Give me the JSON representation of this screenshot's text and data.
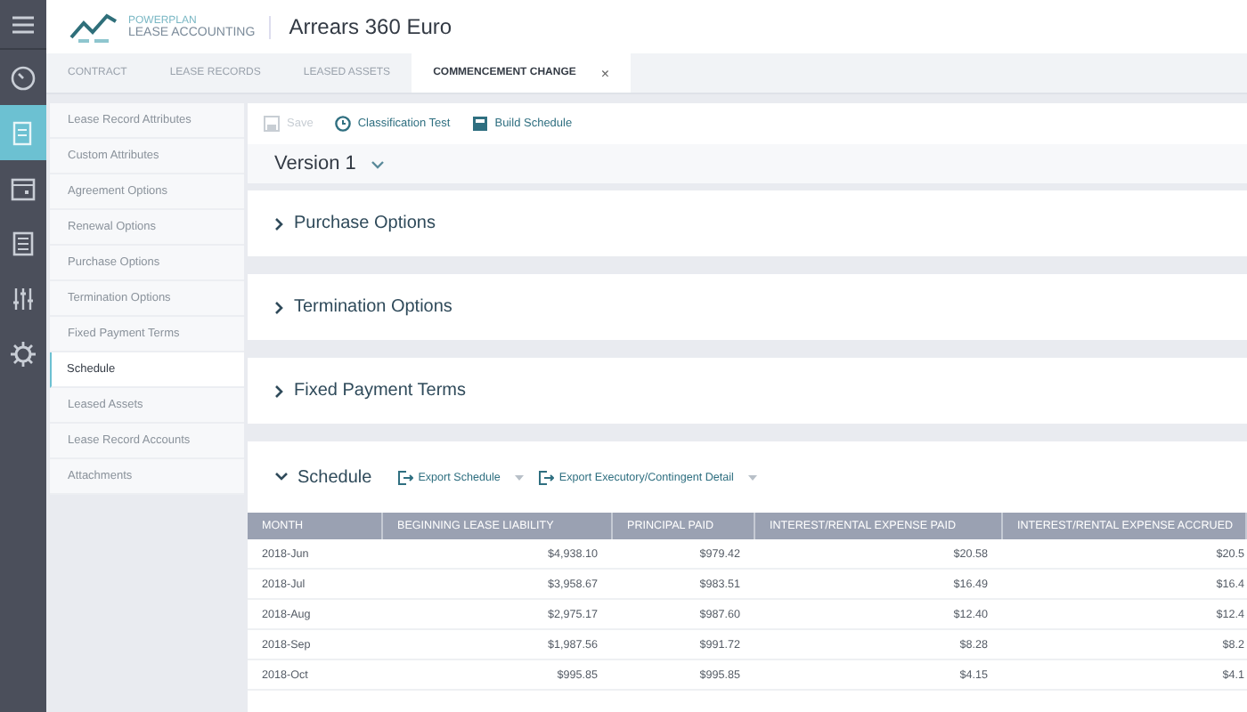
{
  "header": {
    "logo_line1": "POWERPLAN",
    "logo_line2": "LEASE ACCOUNTING",
    "title": "Arrears 360 Euro"
  },
  "rail": [
    {
      "kind": "menu",
      "selected": false
    },
    {
      "kind": "gauge",
      "selected": false
    },
    {
      "kind": "document",
      "selected": true
    },
    {
      "kind": "calendar",
      "selected": false
    },
    {
      "kind": "ledger",
      "selected": false
    },
    {
      "kind": "sliders",
      "selected": false
    },
    {
      "kind": "gear",
      "selected": false
    }
  ],
  "tabs": [
    {
      "label": "CONTRACT",
      "selected": false
    },
    {
      "label": "LEASE RECORDS",
      "selected": false
    },
    {
      "label": "LEASED ASSETS",
      "selected": false
    },
    {
      "label": "COMMENCEMENT CHANGE",
      "selected": true,
      "close": "×"
    }
  ],
  "sidebar": {
    "items": [
      {
        "label": "Lease Record Attributes",
        "selected": false
      },
      {
        "label": "Custom Attributes",
        "selected": false
      },
      {
        "label": "Agreement Options",
        "selected": false
      },
      {
        "label": "Renewal Options",
        "selected": false
      },
      {
        "label": "Purchase Options",
        "selected": false
      },
      {
        "label": "Termination Options",
        "selected": false
      },
      {
        "label": "Fixed Payment Terms",
        "selected": false
      },
      {
        "label": "Schedule",
        "selected": true
      },
      {
        "label": "Leased Assets",
        "selected": false
      },
      {
        "label": "Lease Record Accounts",
        "selected": false
      },
      {
        "label": "Attachments",
        "selected": false
      }
    ]
  },
  "toolbar": [
    {
      "label": "Save",
      "kind": "save",
      "disabled": true
    },
    {
      "label": "Classification Test",
      "kind": "classify",
      "disabled": false
    },
    {
      "label": "Build Schedule",
      "kind": "build",
      "disabled": false
    }
  ],
  "version": {
    "label": "Version 1"
  },
  "sections": [
    {
      "title": "Purchase Options",
      "expanded": false
    },
    {
      "title": "Termination Options",
      "expanded": false
    },
    {
      "title": "Fixed Payment Terms",
      "expanded": false
    }
  ],
  "schedule": {
    "title": "Schedule",
    "expanded": true,
    "actions": [
      "Export Schedule",
      "Export Executory/Contingent Detail"
    ],
    "table": {
      "columns": [
        "MONTH",
        "BEGINNING LEASE LIABILITY",
        "PRINCIPAL PAID",
        "INTEREST/RENTAL EXPENSE PAID",
        "INTEREST/RENTAL EXPENSE ACCRUED"
      ],
      "rows": [
        [
          "2018-Jun",
          "$4,938.10",
          "$979.42",
          "$20.58",
          "$20.5"
        ],
        [
          "2018-Jul",
          "$3,958.67",
          "$983.51",
          "$16.49",
          "$16.4"
        ],
        [
          "2018-Aug",
          "$2,975.17",
          "$987.60",
          "$12.40",
          "$12.4"
        ],
        [
          "2018-Sep",
          "$1,987.56",
          "$991.72",
          "$8.28",
          "$8.2"
        ],
        [
          "2018-Oct",
          "$995.85",
          "$995.85",
          "$4.15",
          "$4.1"
        ]
      ]
    }
  }
}
